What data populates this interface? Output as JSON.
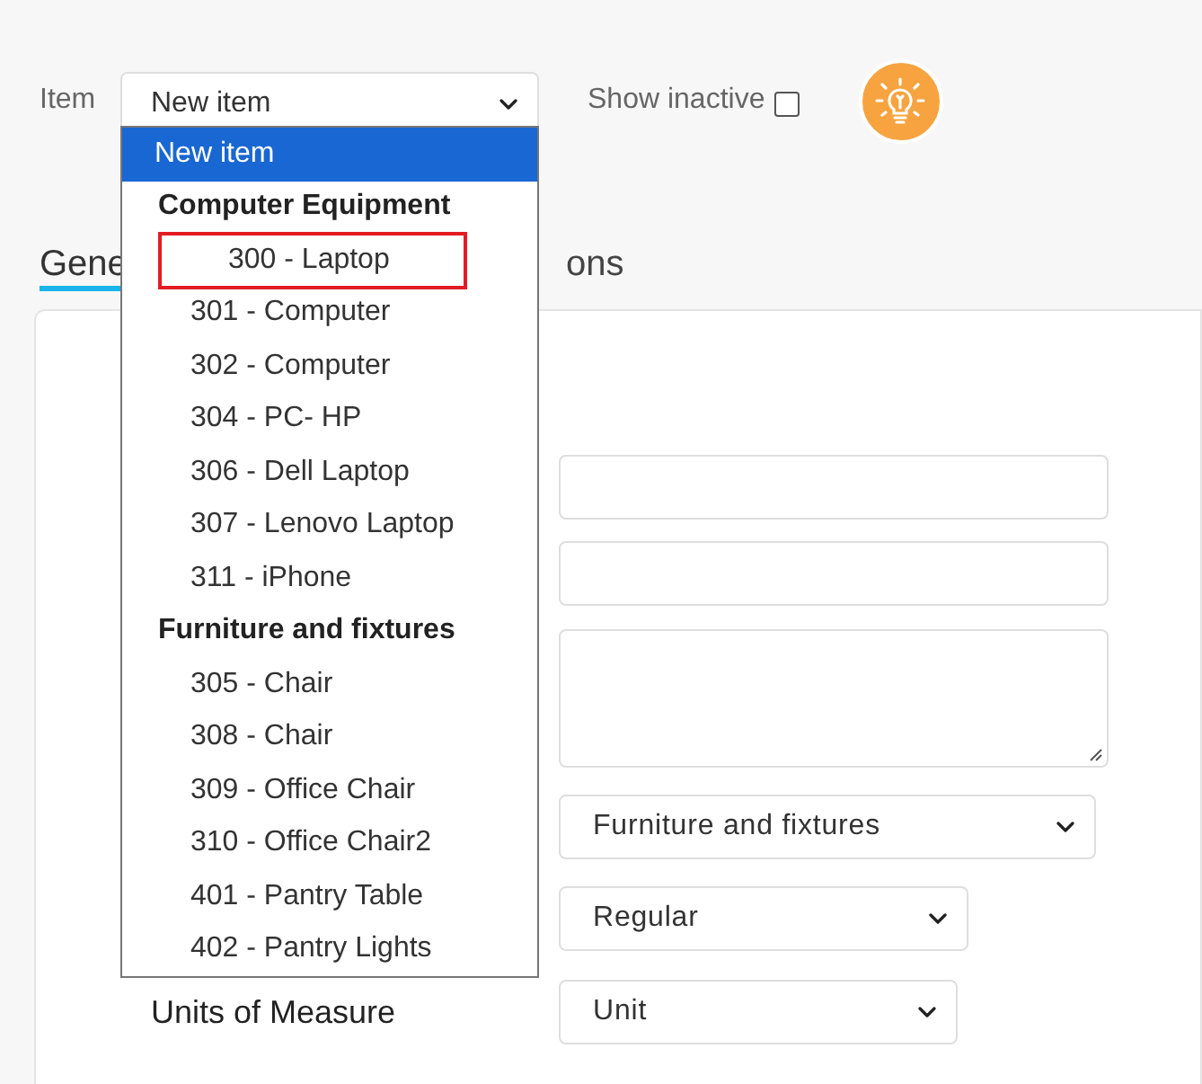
{
  "filter": {
    "label": "Item",
    "value": "New item",
    "show_inactive": {
      "label": "Show inactive",
      "checked": false
    }
  },
  "dropdown": [
    {
      "kind": "option",
      "label": "New item",
      "selected": true,
      "highlighted": false
    },
    {
      "kind": "group",
      "label": "Computer Equipment"
    },
    {
      "kind": "option",
      "label": "300 - Laptop",
      "selected": false,
      "highlighted": true
    },
    {
      "kind": "option",
      "label": "301 - Computer",
      "selected": false,
      "highlighted": false
    },
    {
      "kind": "option",
      "label": "302 - Computer",
      "selected": false,
      "highlighted": false
    },
    {
      "kind": "option",
      "label": "304 - PC- HP",
      "selected": false,
      "highlighted": false
    },
    {
      "kind": "option",
      "label": "306 - Dell Laptop",
      "selected": false,
      "highlighted": false
    },
    {
      "kind": "option",
      "label": "307 - Lenovo Laptop",
      "selected": false,
      "highlighted": false
    },
    {
      "kind": "option",
      "label": "311 - iPhone",
      "selected": false,
      "highlighted": false
    },
    {
      "kind": "group",
      "label": "Furniture and fixtures"
    },
    {
      "kind": "option",
      "label": "305 - Chair",
      "selected": false,
      "highlighted": false
    },
    {
      "kind": "option",
      "label": "308 - Chair",
      "selected": false,
      "highlighted": false
    },
    {
      "kind": "option",
      "label": "309 - Office Chair",
      "selected": false,
      "highlighted": false
    },
    {
      "kind": "option",
      "label": "310 - Office Chair2",
      "selected": false,
      "highlighted": false
    },
    {
      "kind": "option",
      "label": "401 - Pantry Table",
      "selected": false,
      "highlighted": false
    },
    {
      "kind": "option",
      "label": "402 - Pantry Lights",
      "selected": false,
      "highlighted": false
    }
  ],
  "tabs": [
    {
      "label": "Gene",
      "selected": true
    },
    {
      "label": "ons",
      "selected": false
    }
  ],
  "form": [
    {
      "kind": "input"
    },
    {
      "kind": "input"
    },
    {
      "kind": "textarea"
    },
    {
      "kind": "select",
      "value": "Furniture and fixtures"
    },
    {
      "kind": "select",
      "value": "Regular"
    },
    {
      "kind": "select",
      "label": "Units of Measure",
      "value": "Unit"
    }
  ]
}
